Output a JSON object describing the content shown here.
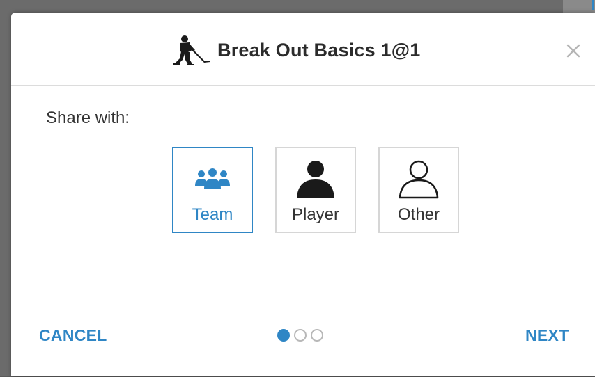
{
  "dialog": {
    "title": "Break Out Basics 1@1",
    "title_icon": "hockey-player-icon",
    "close_icon": "close-icon"
  },
  "share": {
    "label": "Share with:",
    "options": [
      {
        "label": "Team",
        "icon": "team-icon",
        "selected": true
      },
      {
        "label": "Player",
        "icon": "player-icon",
        "selected": false
      },
      {
        "label": "Other",
        "icon": "user-outline-icon",
        "selected": false
      }
    ]
  },
  "footer": {
    "cancel_label": "CANCEL",
    "next_label": "NEXT",
    "pager": {
      "total": 3,
      "current": 1
    }
  },
  "colors": {
    "accent": "#2f86c5",
    "border": "#d6d6d6",
    "text": "#333333"
  }
}
